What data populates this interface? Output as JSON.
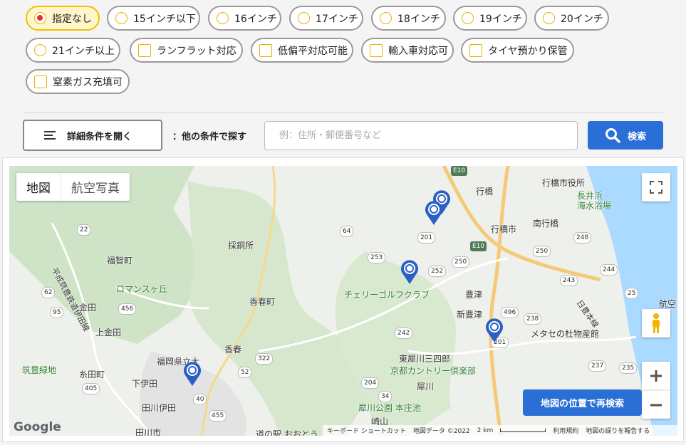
{
  "filters": {
    "sizes": [
      {
        "label": "指定なし",
        "selected": true
      },
      {
        "label": "15インチ以下",
        "selected": false
      },
      {
        "label": "16インチ",
        "selected": false
      },
      {
        "label": "17インチ",
        "selected": false
      },
      {
        "label": "18インチ",
        "selected": false
      },
      {
        "label": "19インチ",
        "selected": false
      },
      {
        "label": "20インチ",
        "selected": false
      },
      {
        "label": "21インチ以上",
        "selected": false
      }
    ],
    "features": [
      {
        "label": "ランフラット対応",
        "checked": false
      },
      {
        "label": "低偏平対応可能",
        "checked": false
      },
      {
        "label": "輸入車対応可",
        "checked": false
      },
      {
        "label": "タイヤ預かり保管",
        "checked": false
      },
      {
        "label": "窒素ガス充填可",
        "checked": false
      }
    ]
  },
  "search": {
    "detail_label": "詳細条件を開く",
    "other_label": "：他の条件で探す",
    "placeholder": "例：住所・郵便番号など",
    "button_label": "検索"
  },
  "map": {
    "type_map": "地図",
    "type_aerial": "航空写真",
    "research_label": "地図の位置で再検索",
    "google": "Google",
    "footer": {
      "shortcuts": "キーボード ショートカット",
      "data": "地図データ ©2022",
      "scale": "2 km",
      "terms": "利用規約",
      "report": "地図の誤りを報告する"
    },
    "places": [
      "行橋市役所",
      "長井浜",
      "海水浴場",
      "行橋",
      "南行橋",
      "行橋市",
      "福智町",
      "採銅所",
      "ロマンスヶ丘",
      "チェリーゴルフクラブ",
      "豊津",
      "新豊津",
      "香春町",
      "金田",
      "上金田",
      "メタセの杜物産館",
      "香春",
      "福岡県立大",
      "東犀川三四郎",
      "京都カントリー倶楽部",
      "筑豊緑地",
      "糸田町",
      "下伊田",
      "犀川",
      "田川伊田",
      "犀川公園 本庄池",
      "崎山",
      "田川市",
      "道の駅 おおとう",
      "航空",
      "平成筑豊鉄道伊田線",
      "日豊本線"
    ],
    "roads": [
      "E10",
      "E10",
      "64",
      "201",
      "22",
      "253",
      "252",
      "250",
      "62",
      "456",
      "95",
      "242",
      "322",
      "52",
      "405",
      "204",
      "34",
      "455",
      "496",
      "238",
      "237",
      "235",
      "25",
      "244",
      "243",
      "248",
      "250",
      "40",
      "201"
    ]
  },
  "colors": {
    "accent": "#2a6fd6",
    "selected_chip_bg": "#fff6cc",
    "selected_chip_border": "#f0c000",
    "radio_dot": "#e83030"
  },
  "icons": [
    "menu-icon",
    "search-icon",
    "fullscreen-icon",
    "pegman-icon",
    "zoom-in-icon",
    "zoom-out-icon",
    "shop-marker-icon"
  ]
}
